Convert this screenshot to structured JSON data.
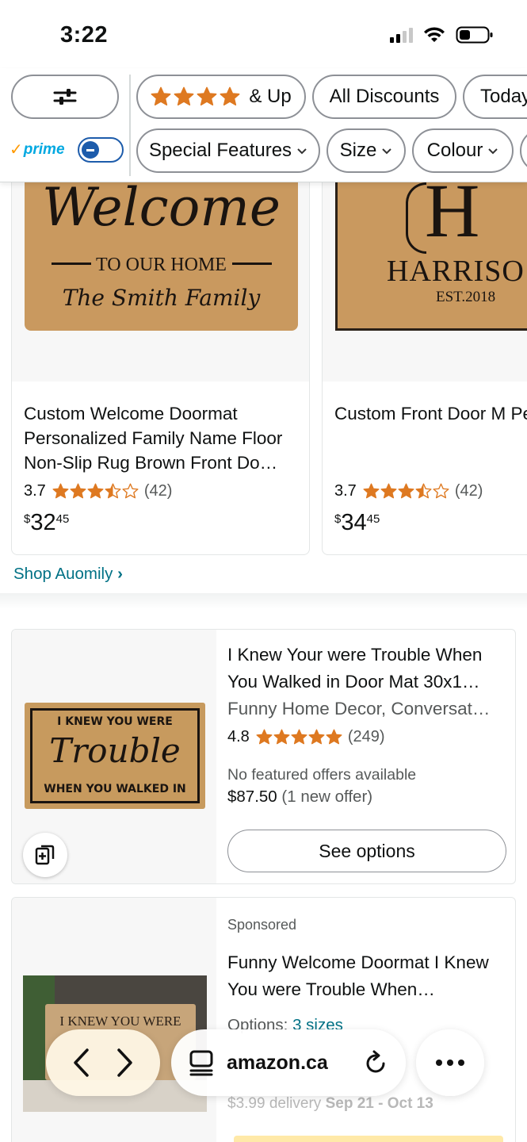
{
  "status_bar": {
    "time": "3:22"
  },
  "filters": {
    "row1": [
      {
        "label": "& Up",
        "has_stars": true
      },
      {
        "label": "All Discounts"
      },
      {
        "label": "Today"
      }
    ],
    "row2": [
      {
        "label": "Special Features"
      },
      {
        "label": "Size"
      },
      {
        "label": "Colour"
      }
    ],
    "prime_label": "prime",
    "prime_toggle": "off"
  },
  "grid_products": [
    {
      "image_lines": [
        "Welcome",
        "TO OUR HOME",
        "The Smith Family"
      ],
      "title": "Custom Welcome Doormat Personalized Family Name Floor Non-Slip Rug Brown Front Do…",
      "rating": "3.7",
      "rating_stars": 3.5,
      "review_count": "(42)",
      "price_symbol": "$",
      "price_whole": "32",
      "price_fraction": "45"
    },
    {
      "image_lines": [
        "H",
        "HARRISO",
        "EST.2018"
      ],
      "title": "Custom Front Door M Personalized Monogra Family Name Floor No",
      "rating": "3.7",
      "rating_stars": 3.5,
      "review_count": "(42)",
      "price_symbol": "$",
      "price_whole": "34",
      "price_fraction": "45"
    }
  ],
  "shop_link": "Shop Auomily",
  "list_products": [
    {
      "image_lines": [
        "I KNEW YOU WERE",
        "Trouble",
        "WHEN YOU WALKED IN"
      ],
      "title": "I Knew Your were Trouble When You Walked in Door Mat 30x1…",
      "subtitle": "Funny Home Decor, Conversat…",
      "rating": "4.8",
      "rating_stars": 5,
      "review_count": "(249)",
      "offer_note": "No featured offers available",
      "price": "$87.50",
      "offer_count": "(1 new offer)",
      "button": "See options"
    },
    {
      "sponsored": "Sponsored",
      "image_lines": [
        "I KNEW YOU WERE"
      ],
      "title": "Funny Welcome Doormat I Knew You were Trouble When…",
      "options_label": "Options:",
      "options_value": "3 sizes",
      "delivery_prefix": "$3.99 delivery",
      "delivery_dates": "Sep 21 - Oct 13"
    }
  ],
  "browser": {
    "url": "amazon.ca"
  },
  "icons": {
    "filter": "sliders-icon",
    "compare": "compare-icon",
    "back": "chevron-left-icon",
    "forward": "chevron-right-icon",
    "tabs": "tabs-icon",
    "reload": "reload-icon",
    "more": "more-icon"
  },
  "colors": {
    "star": "#de7921",
    "link": "#007185",
    "prime_blue": "#00a8e1",
    "prime_check": "#ff9900",
    "toggle": "#1d5cab",
    "mat": "#c79a5e"
  }
}
